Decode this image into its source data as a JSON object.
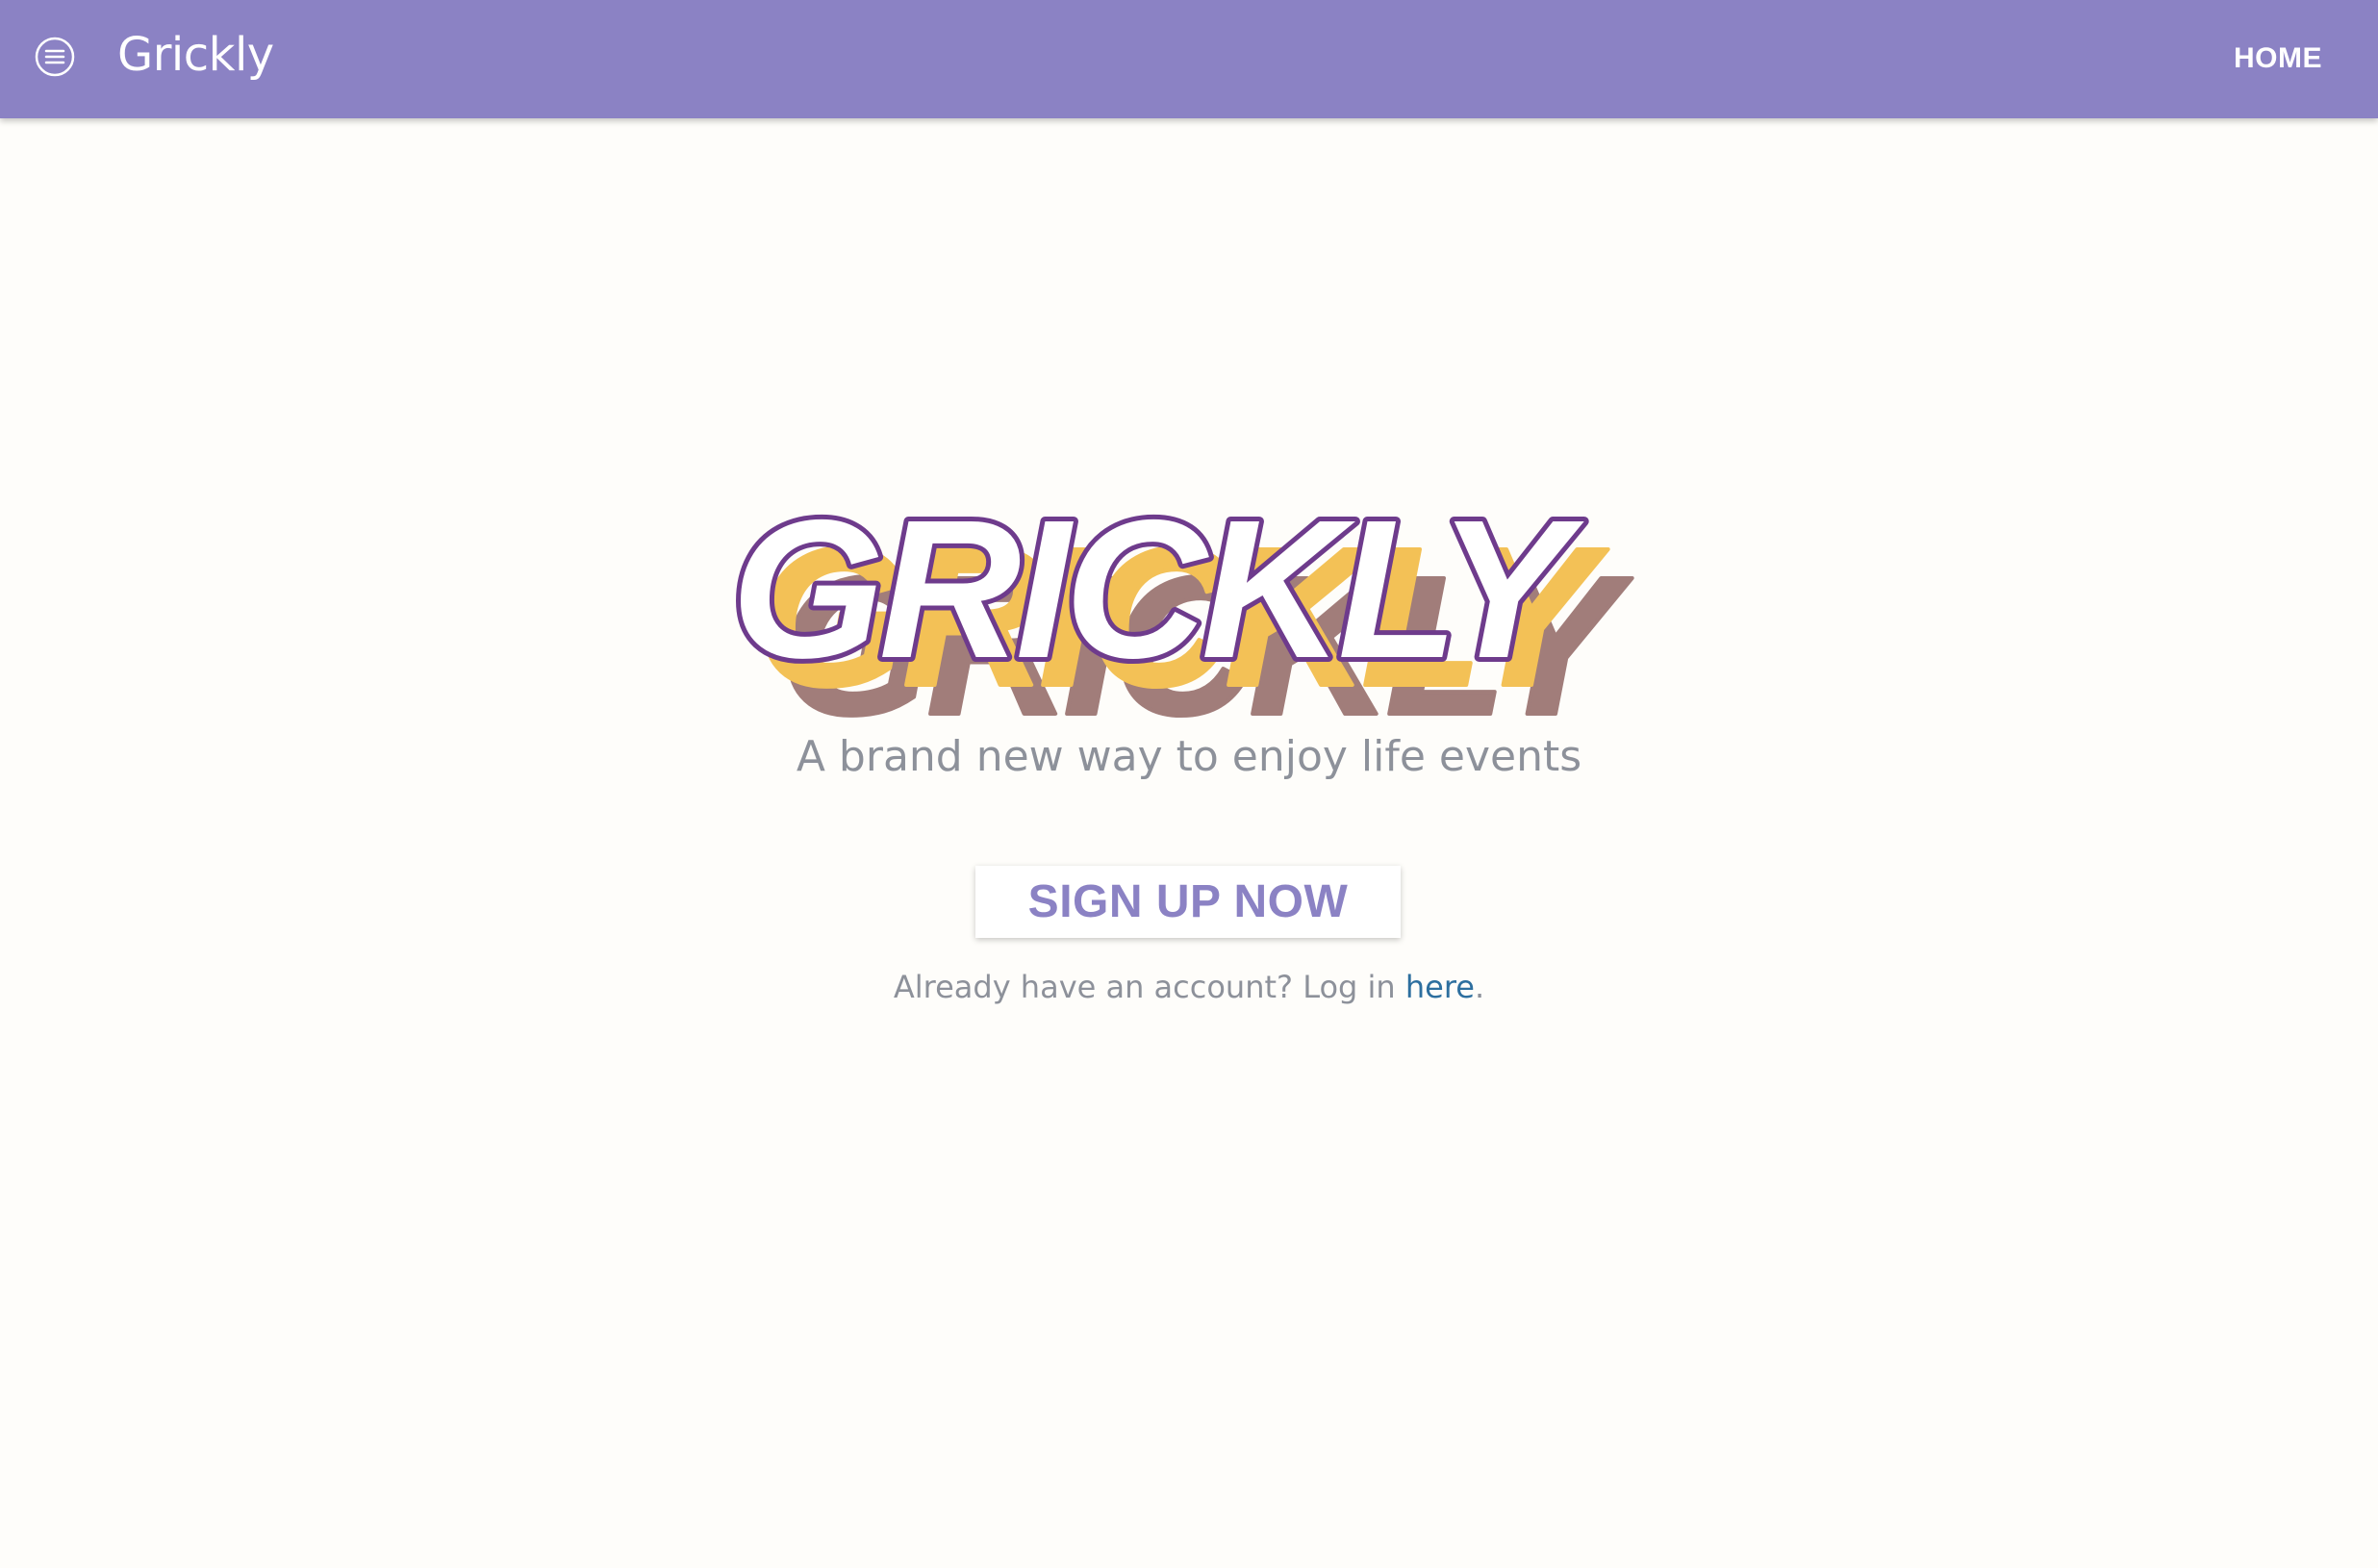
{
  "navbar": {
    "brand": "Grickly",
    "home_link": "HOME",
    "menu_icon": "menu-icon",
    "background_color": "#8b82c4"
  },
  "hero": {
    "logo_text": "GRICKLY",
    "logo_colors": {
      "outline": "#6e3b8c",
      "fill": "#ffffff",
      "shadow_1": "#f3c156",
      "shadow_2": "#a17d7a"
    },
    "tagline": "A brand new way to enjoy life events",
    "signup_label": "SIGN UP NOW",
    "login_prefix": "Already have an account? Log in ",
    "login_link": "here",
    "login_suffix": "."
  },
  "colors": {
    "background": "#fefdfa",
    "accent": "#8b82c4",
    "link": "#2d6f9f",
    "muted_text": "#8d919a"
  }
}
